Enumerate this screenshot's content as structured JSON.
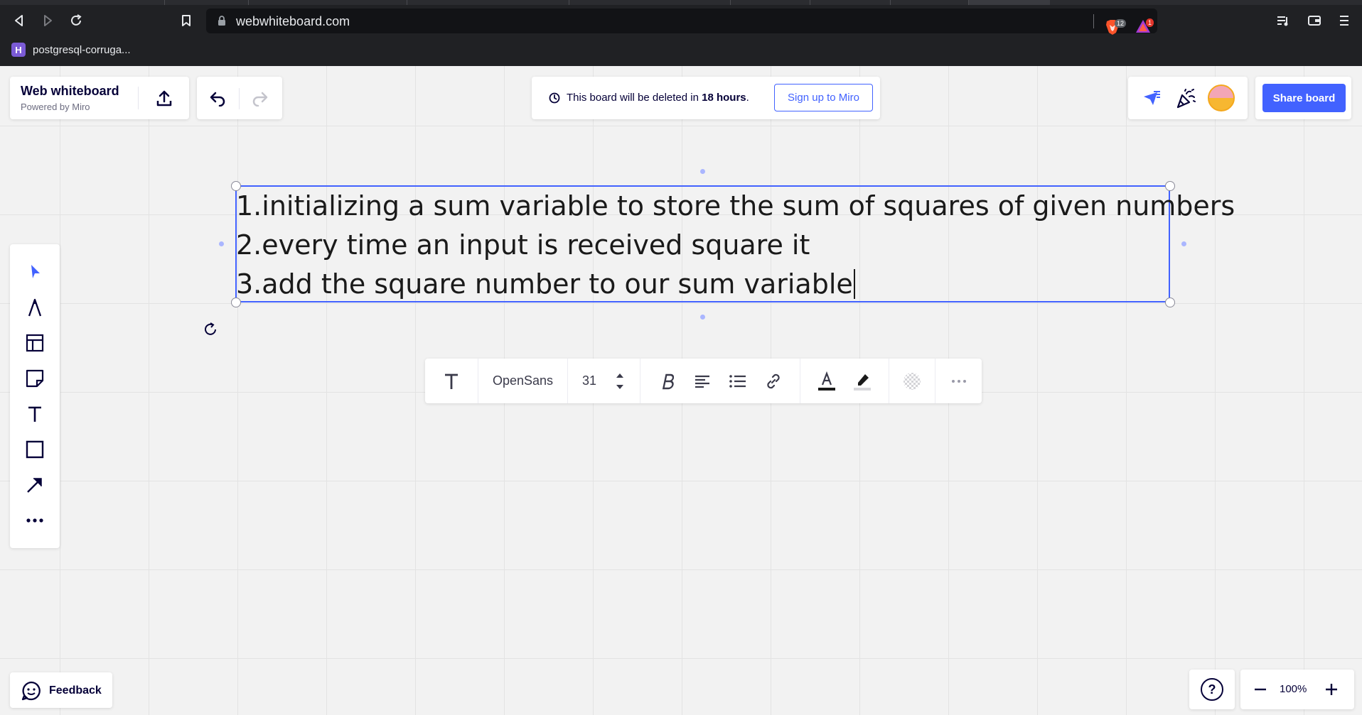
{
  "browser": {
    "url": "webwhiteboard.com",
    "bookmark_label": "postgresql-corruga...",
    "brave_badge": "12",
    "alert_badge": "1"
  },
  "brand": {
    "title": "Web whiteboard",
    "subtitle": "Powered by Miro"
  },
  "notice": {
    "prefix": "This board will be deleted in",
    "hours": "18 hours",
    "suffix": ".",
    "signup_label": "Sign up to Miro"
  },
  "share": {
    "label": "Share board"
  },
  "textbox": {
    "lines": [
      "1.initializing a sum variable to store the sum of squares of given numbers",
      "2.every time an input is received square it",
      "3.add the square number to our sum variable"
    ]
  },
  "format_toolbar": {
    "font_name": "OpenSans",
    "font_size": "31"
  },
  "feedback": {
    "label": "Feedback"
  },
  "help": {
    "label": "?"
  },
  "zoom": {
    "value": "100%"
  },
  "colors": {
    "accent": "#4262ff",
    "browser_bg": "#202124",
    "canvas_bg": "#f2f2f2",
    "text_dark": "#050038"
  }
}
